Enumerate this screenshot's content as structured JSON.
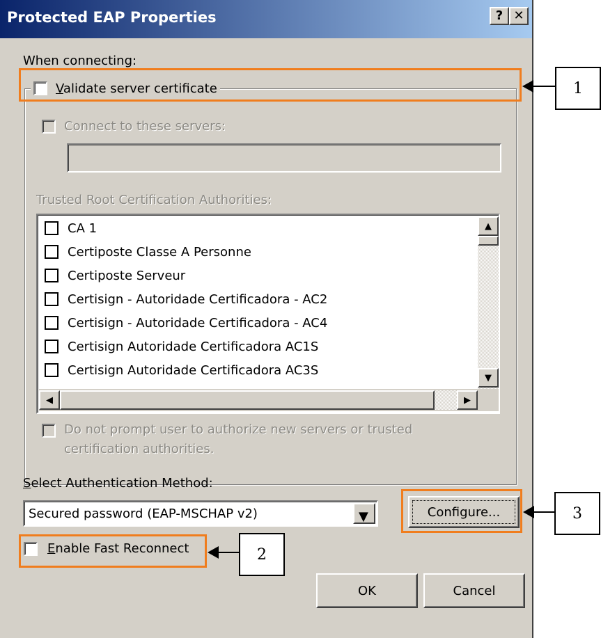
{
  "window": {
    "title": "Protected EAP Properties",
    "help_glyph": "?",
    "close_glyph": "✕"
  },
  "connecting": {
    "heading": "When connecting:",
    "validate_label": "Validate server certificate",
    "validate_checked": false,
    "connect_servers_label": "Connect to these servers:",
    "servers_value": "",
    "trusted_label": "Trusted Root Certification Authorities:",
    "authorities": [
      {
        "name": "CA 1",
        "checked": false
      },
      {
        "name": "Certiposte Classe A Personne",
        "checked": false
      },
      {
        "name": "Certiposte Serveur",
        "checked": false
      },
      {
        "name": "Certisign - Autoridade Certificadora - AC2",
        "checked": false
      },
      {
        "name": "Certisign - Autoridade Certificadora - AC4",
        "checked": false
      },
      {
        "name": "Certisign Autoridade Certificadora AC1S",
        "checked": false
      },
      {
        "name": "Certisign Autoridade Certificadora AC3S",
        "checked": false
      }
    ],
    "no_prompt_line1": "Do not prompt user to authorize new servers or trusted",
    "no_prompt_line2": "certification authorities."
  },
  "auth": {
    "label": "Select Authentication Method:",
    "selected": "Secured password (EAP-MSCHAP v2)",
    "configure_label": "Configure...",
    "fast_reconnect_label": "Enable Fast Reconnect",
    "fast_reconnect_checked": false
  },
  "buttons": {
    "ok": "OK",
    "cancel": "Cancel"
  },
  "callouts": {
    "one": "1",
    "two": "2",
    "three": "3"
  },
  "colors": {
    "highlight": "#f07d1e",
    "title_start": "#0a246a",
    "title_end": "#a6caf0",
    "dialog_bg": "#d4d0c8"
  }
}
